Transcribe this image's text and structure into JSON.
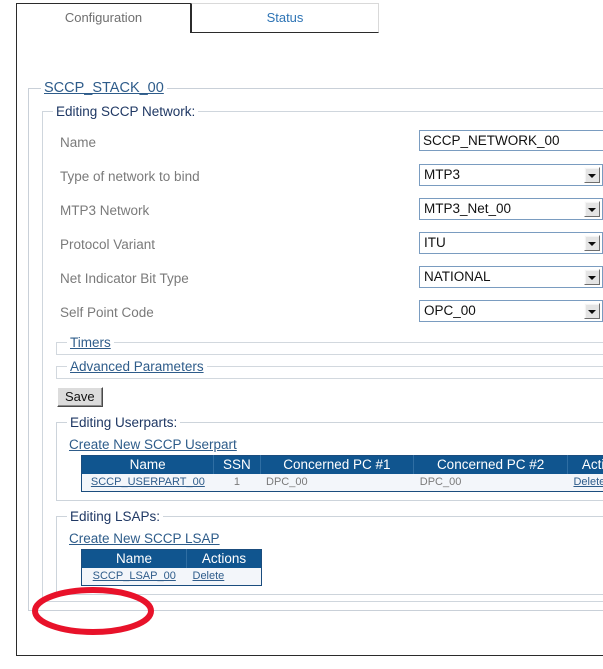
{
  "tabs": [
    {
      "label": "Configuration",
      "active": true
    },
    {
      "label": "Status",
      "active": false
    }
  ],
  "stack": {
    "legend": "SCCP_STACK_00"
  },
  "network_section": {
    "legend": "Editing SCCP Network:",
    "fields": [
      {
        "label": "Name",
        "type": "text",
        "value": "SCCP_NETWORK_00"
      },
      {
        "label": "Type of network to bind",
        "type": "select",
        "value": "MTP3"
      },
      {
        "label": "MTP3 Network",
        "type": "select",
        "value": "MTP3_Net_00"
      },
      {
        "label": "Protocol Variant",
        "type": "select",
        "value": "ITU"
      },
      {
        "label": "Net Indicator Bit Type",
        "type": "select",
        "value": "NATIONAL"
      },
      {
        "label": "Self Point Code",
        "type": "select",
        "value": "OPC_00"
      }
    ],
    "collapsed": [
      {
        "legend": "Timers"
      },
      {
        "legend": "Advanced Parameters"
      }
    ],
    "save_label": "Save"
  },
  "userparts_section": {
    "legend": "Editing Userparts:",
    "create_link": "Create New SCCP Userpart",
    "columns": [
      "Name",
      "SSN",
      "Concerned PC #1",
      "Concerned PC #2",
      "Actions"
    ],
    "rows": [
      {
        "name": "SCCP_USERPART_00",
        "ssn": "1",
        "pc1": "DPC_00",
        "pc2": "DPC_00",
        "action": "Delete"
      }
    ]
  },
  "lsaps_section": {
    "legend": "Editing LSAPs:",
    "create_link": "Create New SCCP LSAP",
    "columns": [
      "Name",
      "Actions"
    ],
    "rows": [
      {
        "name": "SCCP_LSAP_00",
        "action": "Delete"
      }
    ]
  },
  "annotation": {
    "shape": "ellipse",
    "color": "#e8122a",
    "target": "SCCP_LSAP_00"
  },
  "colors": {
    "table_header": "#10558f",
    "link": "#2e5c8a",
    "label": "#7a7a7a",
    "legend": "#1f3864",
    "annotation": "#e8122a"
  }
}
